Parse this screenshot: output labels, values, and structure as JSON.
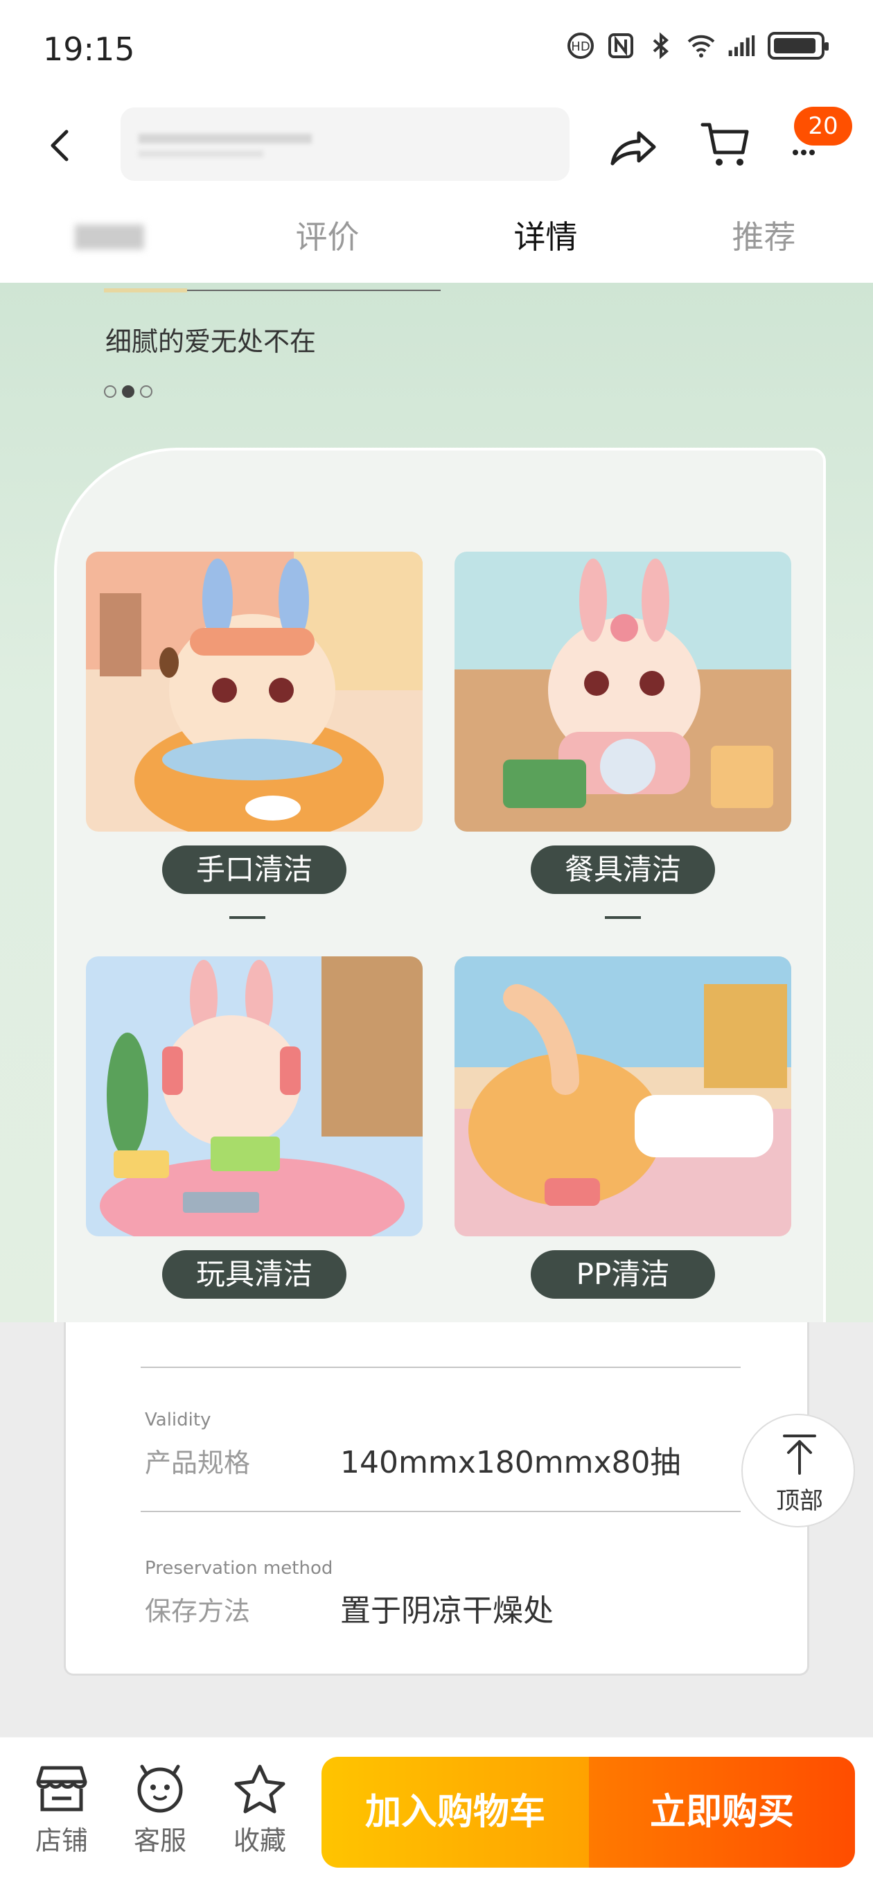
{
  "status_bar": {
    "time": "19:15",
    "icons": [
      "hd-icon",
      "nfc-icon",
      "bluetooth-icon",
      "wifi-6-icon",
      "signal-icon",
      "battery-icon"
    ]
  },
  "nav": {
    "cart_badge": "20",
    "icons": [
      "back-arrow-icon",
      "share-icon",
      "cart-icon"
    ]
  },
  "tabs": [
    {
      "label": "",
      "active": false
    },
    {
      "label": "评价",
      "active": false
    },
    {
      "label": "详情",
      "active": true
    },
    {
      "label": "推荐",
      "active": false
    }
  ],
  "detail": {
    "tagline": "细腻的爱无处不在",
    "carousel": {
      "count": 3,
      "active_index": 1
    },
    "tiles": [
      {
        "label": "手口清洁"
      },
      {
        "label": "餐具清洁"
      },
      {
        "label": "玩具清洁"
      },
      {
        "label": "PP清洁"
      }
    ]
  },
  "specs": [
    {
      "en": "Validity",
      "label": "产品规格",
      "value": "140mmx180mmx80抽"
    },
    {
      "en": "Preservation method",
      "label": "保存方法",
      "value": "置于阴凉干燥处"
    }
  ],
  "back_to_top": {
    "label": "顶部"
  },
  "bottom_bar": {
    "shop": "店铺",
    "service": "客服",
    "favorite": "收藏",
    "add_to_cart": "加入购物车",
    "buy_now": "立即购买"
  },
  "colors": {
    "accent": "#ff5000",
    "cart_button": "#ffb300",
    "buy_button": "#ff5a00",
    "pill": "#3f4c46",
    "content_bg": "#d8ebdb"
  }
}
